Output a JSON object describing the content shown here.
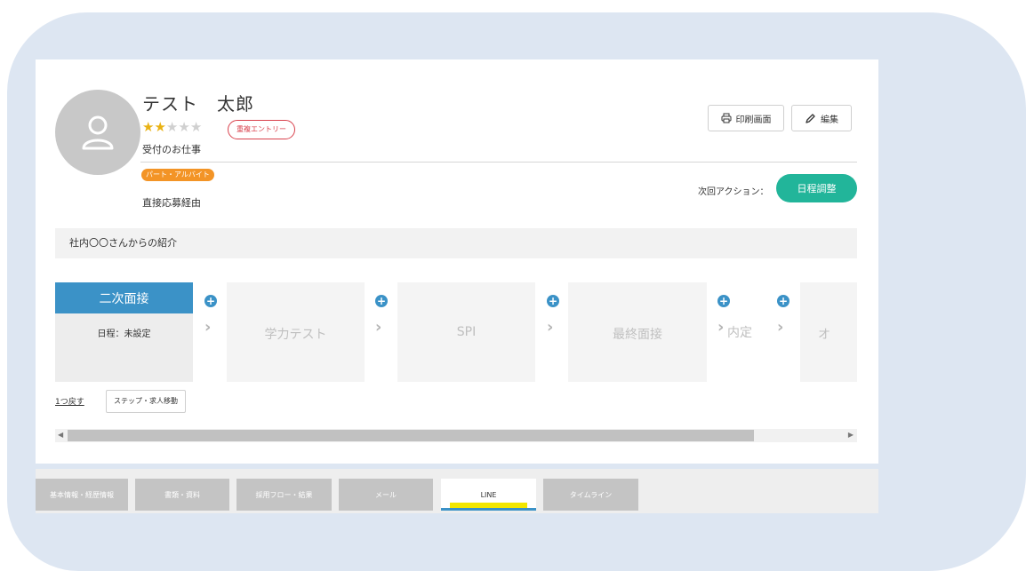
{
  "candidate": {
    "name": "テスト　太郎",
    "rating": 2,
    "rating_max": 5,
    "duplicate_badge": "重複エントリー",
    "job": "受付のお仕事",
    "employment_type": "パート・アルバイト",
    "source": "直接応募経由"
  },
  "actions": {
    "print_label": "印刷画面",
    "edit_label": "編集",
    "next_action_label": "次回アクション：",
    "next_action_button": "日程調整"
  },
  "memo": "社内〇〇さんからの紹介",
  "flow": {
    "active_step": {
      "title": "二次面接",
      "date": "日程：未設定"
    },
    "steps": [
      "学力テスト",
      "SPI",
      "最終面接",
      "内定",
      "オ"
    ],
    "back_link": "1つ戻す",
    "move_button": "ステップ・求人移動"
  },
  "tabs": [
    {
      "label": "基本情報・経歴情報",
      "active": false
    },
    {
      "label": "書類・資料",
      "active": false
    },
    {
      "label": "採用フロー・結果",
      "active": false
    },
    {
      "label": "メール",
      "active": false
    },
    {
      "label": "LINE",
      "active": true
    },
    {
      "label": "タイムライン",
      "active": false
    }
  ],
  "colors": {
    "accent_blue": "#3b92c7",
    "green_button": "#22b59a",
    "star": "#e9b214",
    "duplicate": "#d9414c",
    "type_badge": "#f39426"
  },
  "icons": {
    "avatar": "user-icon",
    "print": "printer-icon",
    "edit": "pencil-icon",
    "add": "plus-icon",
    "next": "chevron-right-icon"
  }
}
